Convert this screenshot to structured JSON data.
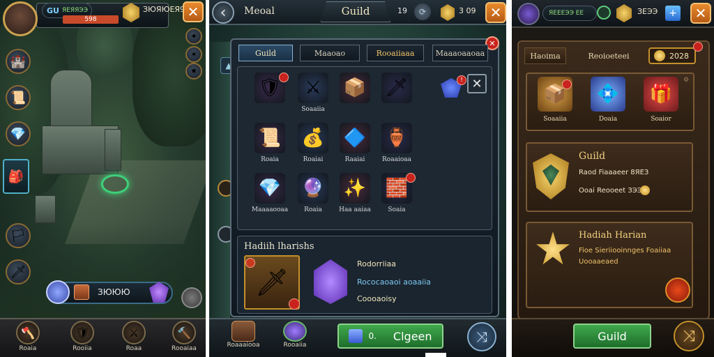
{
  "left": {
    "header": {
      "player": "GU",
      "level_text": "ЯЕЯЯЭЭ",
      "gold": "ЗЮЯЮЕЯ9",
      "bar": "598"
    },
    "resource_bar": {
      "value": "ЗЮЮЮ"
    },
    "nav": [
      {
        "label": "Roaia",
        "icon": "axe-icon"
      },
      {
        "label": "Rooiia",
        "icon": "shield-icon"
      },
      {
        "label": "Roaa",
        "icon": "sword-icon"
      },
      {
        "label": "Rooaiaa",
        "icon": "hammer-icon"
      }
    ]
  },
  "middle": {
    "header": {
      "back": "‹",
      "title_left": "Meoal",
      "title": "Guild",
      "counter": "19",
      "gold": "3 09"
    },
    "tabs": [
      "Guild",
      "Maaoao",
      "Rooaiiaaa",
      "Maaaoaaoaa"
    ],
    "items": [
      {
        "name": "",
        "art": "🛡",
        "badge": true
      },
      {
        "name": "Soaaiia",
        "art": "⚔",
        "badge": false
      },
      {
        "name": "",
        "art": "📦",
        "badge": false
      },
      {
        "name": "",
        "art": "🗡",
        "badge": false
      },
      {
        "name": "Roaia",
        "art": "📜",
        "badge": false
      },
      {
        "name": "Roaiai",
        "art": "💰",
        "badge": false
      },
      {
        "name": "Raaiai",
        "art": "🔷",
        "badge": false
      },
      {
        "name": "Roaaioaa",
        "art": "🏺",
        "badge": false
      },
      {
        "name": "Maaaaooaa",
        "art": "💎",
        "badge": false
      },
      {
        "name": "Roaia",
        "art": "🔮",
        "badge": false
      },
      {
        "name": "Haa aaiaa",
        "art": "✨",
        "badge": false
      },
      {
        "name": "Soaia",
        "art": "🧱",
        "badge": true
      }
    ],
    "detail": {
      "title": "Hadiih lharishs",
      "line1": "Rodorriiaa",
      "line2": "Rococaoaoi aoaaiia",
      "line3": "Coooaoisy"
    },
    "footer": {
      "nav1": "Roaaaiooa",
      "nav2": "Rooaiia",
      "btn_num": "0.",
      "btn_label": "Clgeen"
    }
  },
  "right": {
    "header": {
      "level_text": "ЯЕЕЕЭЭ ЕЕ",
      "gold": "ЗЕЭЭ"
    },
    "tabs": [
      "Haoima",
      "Reoioeteei"
    ],
    "coins": "2028",
    "chests": [
      {
        "name": "Soaaiia",
        "art": "📦"
      },
      {
        "name": "Doaia",
        "art": "💠"
      },
      {
        "name": "Soaior",
        "art": "🎁"
      }
    ],
    "guild": {
      "title": "Guild",
      "line1": "Raod Fiaaaeer 8ЯЕЗ",
      "line2": "Ooai Reooeet ЗЭЭЯ"
    },
    "hadiah": {
      "title": "Hadiah Harian",
      "line1": "Fioe Sieriiooinnges Foaiiaa",
      "line2": "Uooaaeaed"
    },
    "footer": {
      "btn_label": "Guild"
    }
  }
}
